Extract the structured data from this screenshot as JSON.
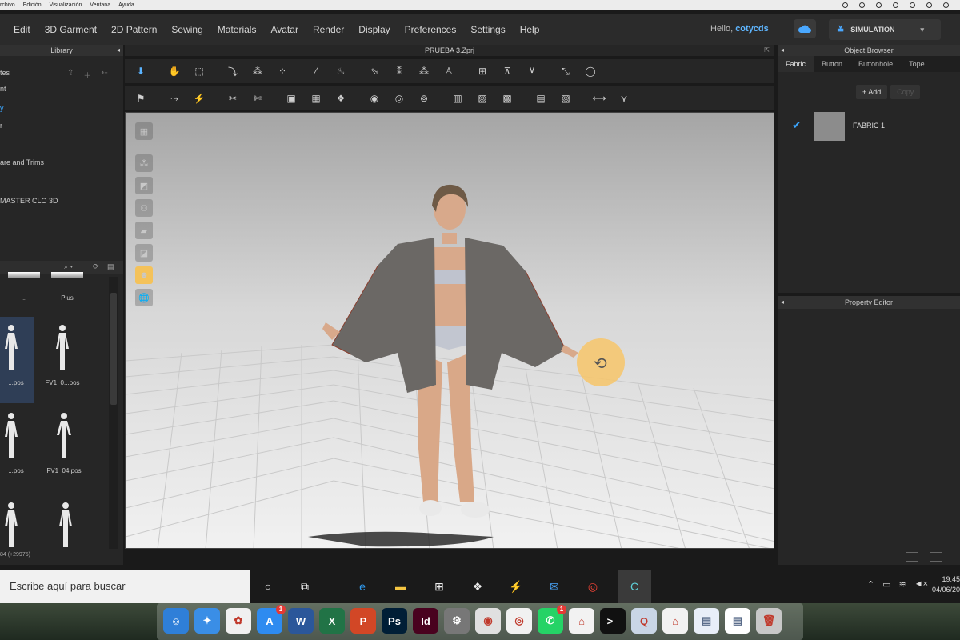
{
  "mac_menubar": {
    "items": [
      "rchivo",
      "Edición",
      "Visualización",
      "Ventana",
      "Ayuda"
    ]
  },
  "app": {
    "menu": [
      "Edit",
      "3D Garment",
      "2D Pattern",
      "Sewing",
      "Materials",
      "Avatar",
      "Render",
      "Display",
      "Preferences",
      "Settings",
      "Help"
    ],
    "hello_prefix": "Hello,",
    "username": "cotycds",
    "simulation_label": "SIMULATION",
    "accent": "#3ba6ff"
  },
  "library": {
    "title": "Library",
    "tree": [
      "tes",
      "nt",
      "y",
      "r",
      "are and Trims",
      "MASTER CLO 3D"
    ],
    "grid": [
      {
        "label": "...",
        "selected": false
      },
      {
        "label": "Plus",
        "selected": false
      },
      {
        "label": "...pos",
        "selected": true
      },
      {
        "label": "FV1_0...pos",
        "selected": false
      },
      {
        "label": "...pos",
        "selected": false
      },
      {
        "label": "FV1_04.pos",
        "selected": false
      },
      {
        "label": "",
        "selected": false
      },
      {
        "label": "",
        "selected": false
      }
    ],
    "footer": "84 (+29975)"
  },
  "viewport": {
    "file_title": "PRUEBA 3.Zprj"
  },
  "object_browser": {
    "title": "Object Browser",
    "tabs": [
      "Fabric",
      "Button",
      "Buttonhole",
      "Tope"
    ],
    "active_tab": "Fabric",
    "add_label": "+ Add",
    "copy_label": "Copy",
    "fabrics": [
      {
        "name": "FABRIC 1",
        "color": "#8c8c8c",
        "checked": true
      }
    ]
  },
  "property_editor": {
    "title": "Property Editor"
  },
  "taskbar": {
    "search_placeholder": "Escribe aquí para buscar",
    "time": "19:45",
    "date": "04/06/20"
  },
  "dock": {
    "apps": [
      {
        "name": "Finder",
        "glyph": "☺",
        "color": "#2f7fd8"
      },
      {
        "name": "Safari",
        "glyph": "✦",
        "color": "#3a8ee6"
      },
      {
        "name": "Photos",
        "glyph": "✿",
        "color": "#f0f0f0"
      },
      {
        "name": "App Store",
        "glyph": "A",
        "color": "#2e8bf0",
        "badge": "1"
      },
      {
        "name": "Word",
        "glyph": "W",
        "color": "#2b579a"
      },
      {
        "name": "Excel",
        "glyph": "X",
        "color": "#217346"
      },
      {
        "name": "PowerPoint",
        "glyph": "P",
        "color": "#d24726"
      },
      {
        "name": "Photoshop",
        "glyph": "Ps",
        "color": "#001e36"
      },
      {
        "name": "InDesign",
        "glyph": "Id",
        "color": "#49021f"
      },
      {
        "name": "System Preferences",
        "glyph": "⚙",
        "color": "#777777"
      },
      {
        "name": "Screen Capture",
        "glyph": "◉",
        "color": "#e0e0e0"
      },
      {
        "name": "Chrome",
        "glyph": "◎",
        "color": "#f1f1f1"
      },
      {
        "name": "WhatsApp",
        "glyph": "✆",
        "color": "#25d366",
        "badge": "1"
      },
      {
        "name": "Acrobat",
        "glyph": "⌂",
        "color": "#f2f2f2"
      },
      {
        "name": "Terminal",
        "glyph": ">_",
        "color": "#111111"
      },
      {
        "name": "QuickTime",
        "glyph": "Q",
        "color": "#c9d6e6"
      },
      {
        "name": "PDF",
        "glyph": "⌂",
        "color": "#f2f2f2"
      },
      {
        "name": "Document",
        "glyph": "▤",
        "color": "#e8eef8"
      },
      {
        "name": "Text File",
        "glyph": "▤",
        "color": "#ffffff"
      },
      {
        "name": "Trash",
        "glyph": "🗑",
        "color": "#c8c8c8"
      }
    ]
  }
}
